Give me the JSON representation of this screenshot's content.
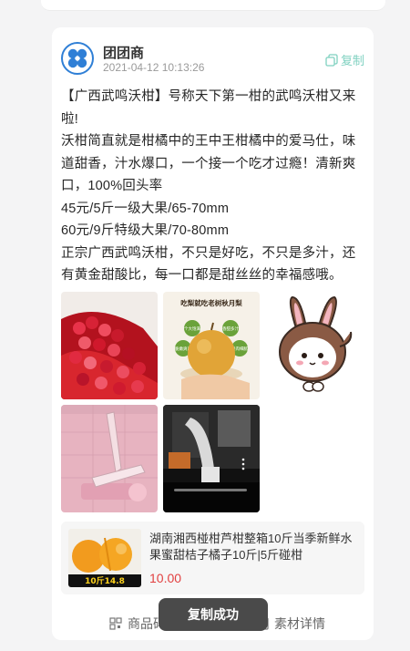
{
  "post": {
    "author": "团团商",
    "timestamp": "2021-04-12 10:13:26",
    "copy_label": "复制",
    "lines": [
      "【广西武鸣沃柑】号称天下第一柑的武鸣沃柑又来啦!",
      "沃柑简直就是柑橘中的王中王柑橘中的爱马仕，味道甜香，汁水爆口，一个接一个吃才过瘾！清新爽口，100%回头率",
      "45元/5斤一级大果/65-70mm",
      "60元/9斤特级大果/70-80mm",
      "正宗广西武鸣沃柑，不只是好吃，不只是多汁，还有黄金甜酸比，每一口都是甜丝丝的幸福感哦。"
    ]
  },
  "images": {
    "pear_poster": {
      "title": "吃梨就吃老树秋月梨",
      "tags": [
        "个大饱满",
        "香甜多汁",
        "脆嫩爽口",
        "果肉细腻"
      ]
    }
  },
  "product": {
    "title": "湖南湘西椪柑芦柑整箱10斤当季新鲜水果蜜甜桔子橘子10斤|5斤碰柑",
    "price": "10.00",
    "thumb_badge": "10斤14.8"
  },
  "bottom": {
    "goods_label": "商品码",
    "detail_label": "素材详情"
  },
  "toast": {
    "text": "复制成功"
  },
  "colors": {
    "accent": "#7fd1c0",
    "price": "#e24141",
    "avatar_ring": "#2f7fd6"
  }
}
